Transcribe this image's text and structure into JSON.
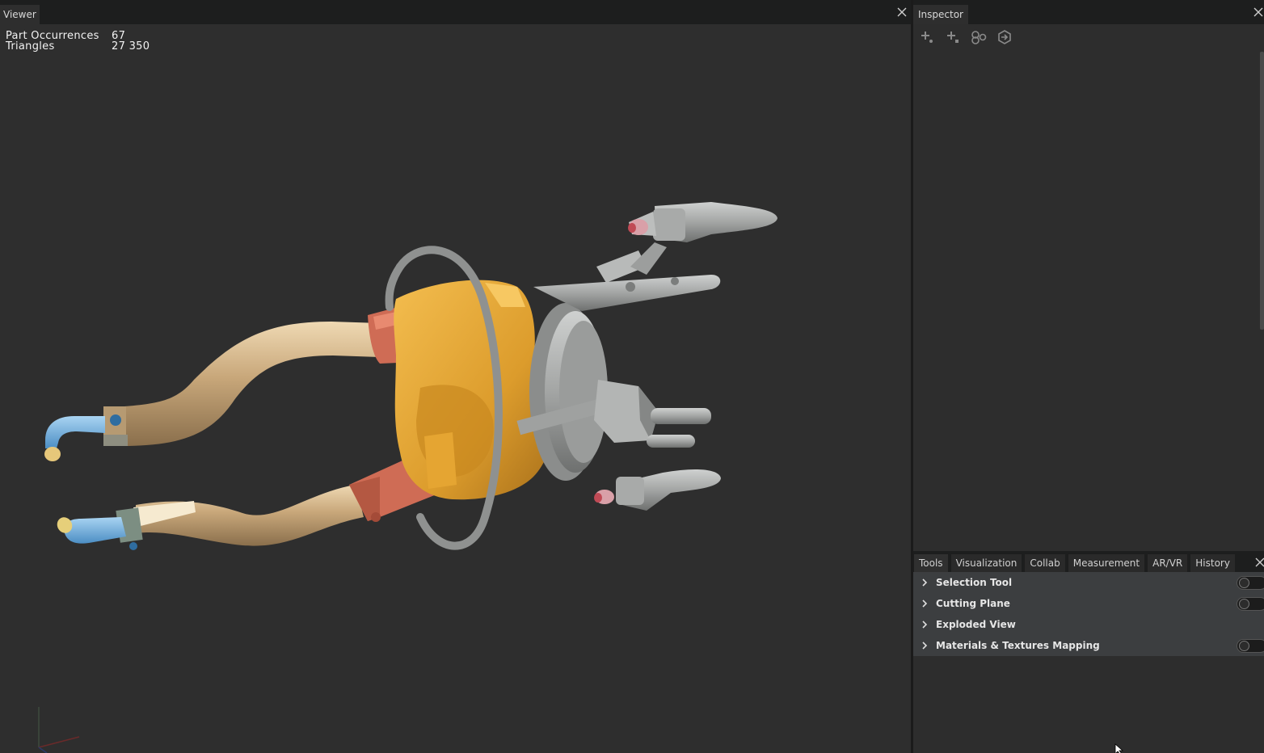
{
  "viewer": {
    "tab_label": "Viewer",
    "stats": {
      "part_occurrences_label": "Part Occurrences",
      "part_occurrences_value": "67",
      "triangles_label": "Triangles",
      "triangles_value": "27 350"
    }
  },
  "inspector": {
    "tab_label": "Inspector",
    "toolbar_icons": [
      "add-property-icon",
      "add-component-icon",
      "link-icon",
      "export-icon"
    ]
  },
  "tools_panel": {
    "tabs": [
      "Tools",
      "Visualization",
      "Collab",
      "Measurement",
      "AR/VR",
      "History"
    ],
    "active_tab": "Tools",
    "items": [
      {
        "label": "Selection Tool",
        "has_toggle": true,
        "toggle_on": false
      },
      {
        "label": "Cutting Plane",
        "has_toggle": true,
        "toggle_on": false
      },
      {
        "label": "Exploded View",
        "has_toggle": false
      },
      {
        "label": "Materials & Textures Mapping",
        "has_toggle": true,
        "toggle_on": false
      }
    ]
  },
  "colors": {
    "background": "#2e2e2e",
    "header": "#1d1e1e",
    "tan_arm": "#c8a77a",
    "orange_body": "#e0a032",
    "salmon": "#cf6c55",
    "steel": "#a0a2a1",
    "blue_tip": "#6aa8d8"
  }
}
